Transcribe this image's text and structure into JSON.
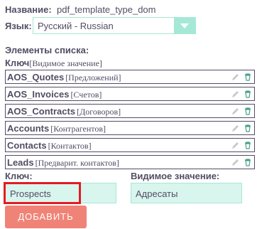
{
  "name_label": "Название:",
  "name_value": "pdf_template_type_dom",
  "lang_label": "Язык:",
  "lang_select": "Русский - Russian",
  "list_label": "Элементы списка:",
  "header": {
    "key": "Ключ",
    "display": "[Видимое значение]"
  },
  "items": [
    {
      "key": "AOS_Quotes",
      "display": "[Предложений]"
    },
    {
      "key": "AOS_Invoices",
      "display": "[Счетов]"
    },
    {
      "key": "AOS_Contracts",
      "display": "[Договоров]"
    },
    {
      "key": "Accounts",
      "display": "[Контрагентов]"
    },
    {
      "key": "Contacts",
      "display": "[Контактов]"
    },
    {
      "key": "Leads",
      "display": "[Предварит. контактов]"
    }
  ],
  "new_key_label": "Ключ:",
  "new_key_value": "Prospects",
  "new_display_label": "Видимое значение:",
  "new_display_value": "Адресаты",
  "add_button": "ДОБАВИТЬ",
  "colors": {
    "accent": "#a5e8d6",
    "input_bg": "#d8f5ee",
    "button": "#f08377",
    "highlight": "#e31b23"
  }
}
